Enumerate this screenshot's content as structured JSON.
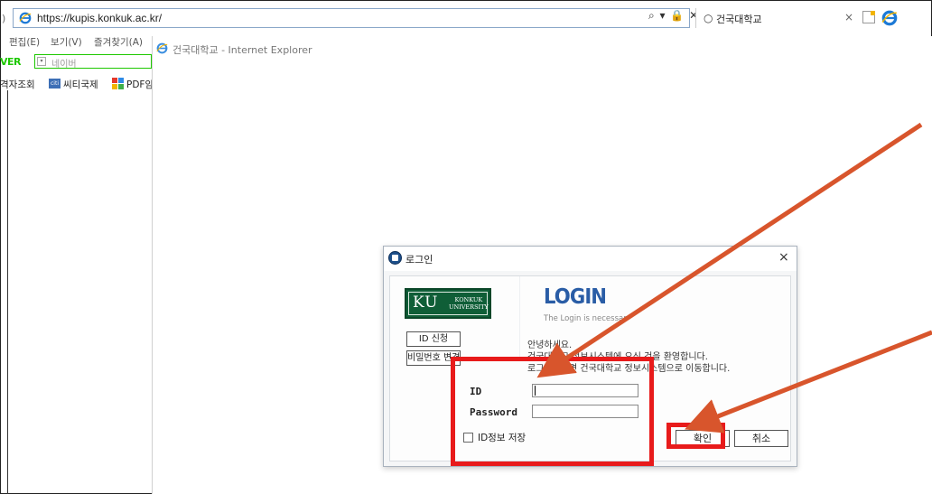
{
  "browser": {
    "left_stub": ")",
    "url": "https://kupis.konkuk.ac.kr/",
    "addr_tools": "⌕ ▾ 🔒 ✕",
    "tab_title": "건국대학교",
    "tab_close": "×"
  },
  "menu": {
    "items": [
      "편집(E)",
      "보기(V)",
      "즐겨찾기(A)"
    ]
  },
  "naver": {
    "logo": "VER",
    "placeholder": "네이버"
  },
  "favorites": {
    "items": [
      "격자조회",
      "씨티국제",
      "PDF암"
    ],
    "city_icon_text": "citi"
  },
  "popup": {
    "title": "건국대학교 - Internet Explorer"
  },
  "login_dialog": {
    "title": "로그인",
    "close": "×",
    "logo_mark": "KU",
    "logo_name_line1": "KONKUK",
    "logo_name_line2": "UNIVERSITY",
    "heading": "LOGIN",
    "subheading": "The Login is necessar",
    "id_apply_button": "ID 신청",
    "pw_change_button": "비밀번호 변경",
    "greeting": [
      "안녕하세요.",
      "건국대학교 정보시스템에 오신 것을 환영합니다.",
      "로그인하시면 건국대학교 정보시스템으로 이동합니다."
    ],
    "id_label": "ID",
    "id_value": "",
    "password_label": "Password",
    "password_value": "",
    "save_id_label": "ID정보 저장",
    "save_id_checked": false,
    "confirm_button": "확인",
    "cancel_button": "취소"
  },
  "colors": {
    "annotation": "#e81b1b",
    "arrow": "#d8552c",
    "ku_green": "#0f5e37",
    "login_blue": "#2a5da6",
    "naver_green": "#1ec800"
  },
  "icons": [
    "ie-logo-icon",
    "search-icon",
    "lock-icon",
    "refresh-icon",
    "new-tab-icon",
    "dropdown-icon",
    "citi-icon",
    "pdf-icon",
    "ku-login-icon",
    "close-icon",
    "checkbox-icon"
  ]
}
